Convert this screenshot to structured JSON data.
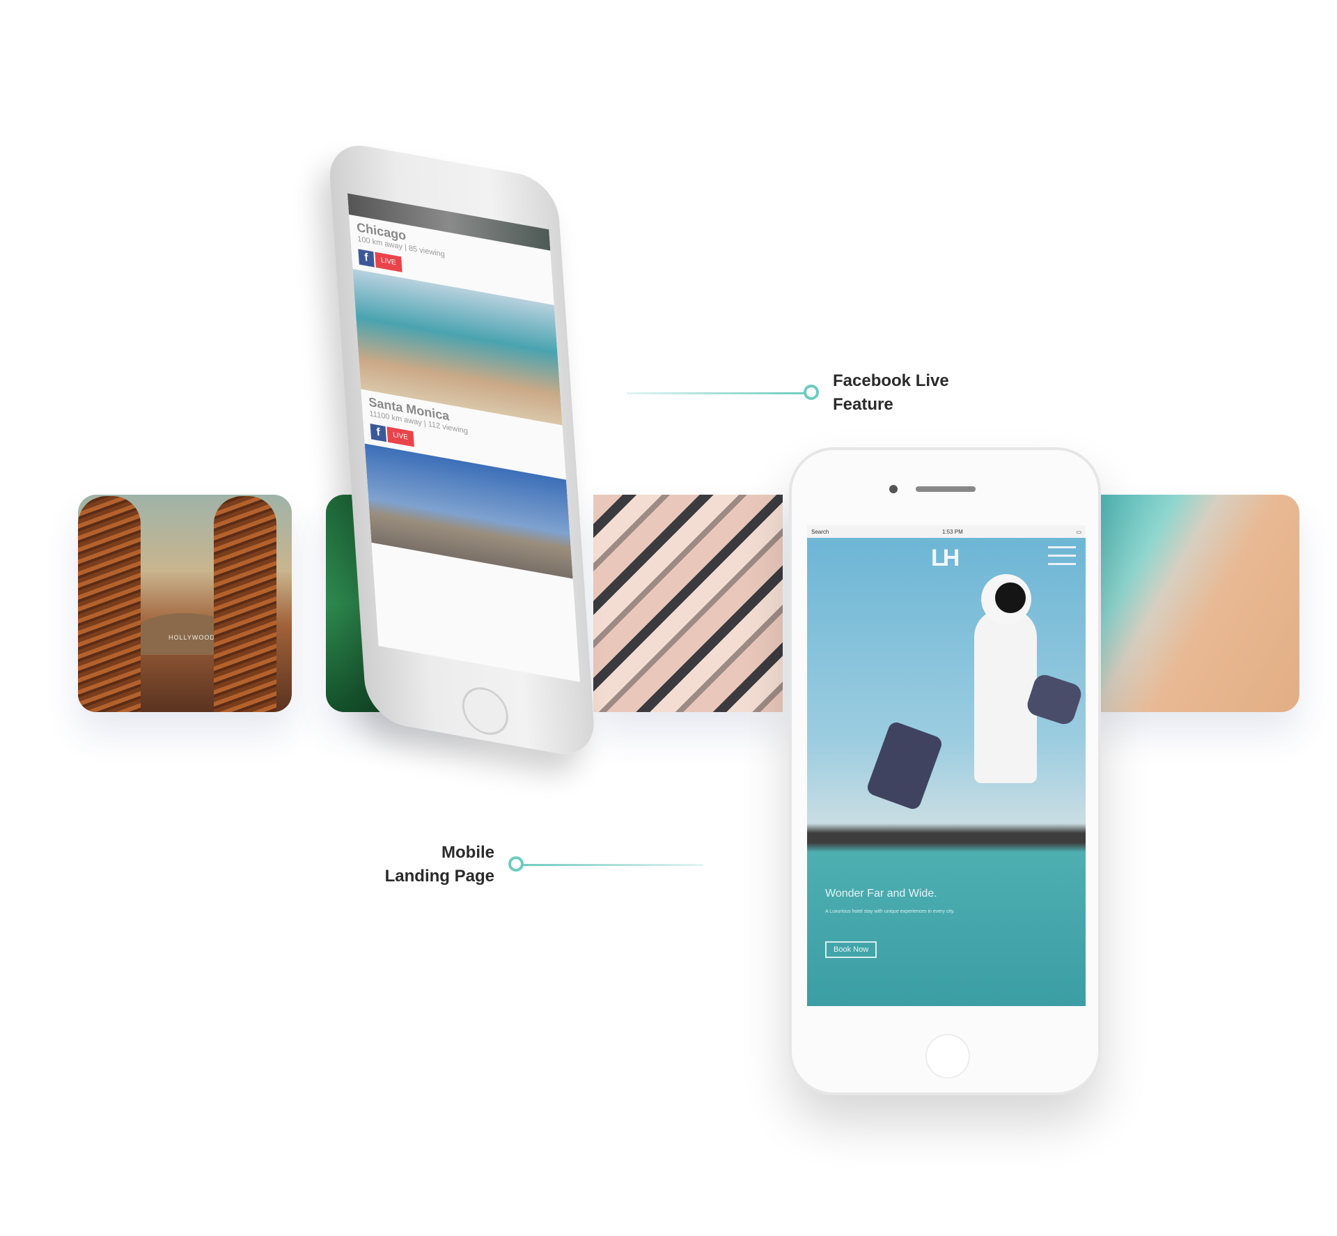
{
  "callouts": {
    "facebook": {
      "line1": "Facebook Live",
      "line2": "Feature"
    },
    "landing": {
      "line1": "Mobile",
      "line2": "Landing Page"
    }
  },
  "phone1": {
    "city1": "Chicago",
    "city1_sub": "100 km away | 85 viewing",
    "live_label": "LIVE",
    "city2": "Santa Monica",
    "city2_sub": "11100 km away | 112 viewing"
  },
  "phone2": {
    "status_left": "Search",
    "status_time": "1:53 PM",
    "logo": "LH",
    "tagline": "Wonder Far and Wide.",
    "description": "A Luxurious hotel stay with unique experiences in every city.",
    "cta": "Book Now"
  },
  "hollywood_sign": "HOLLYWOOD",
  "colors": {
    "accent": "#6ccbbf",
    "text": "#2a2a2a",
    "facebook": "#3b5998",
    "live": "#e9444a"
  }
}
